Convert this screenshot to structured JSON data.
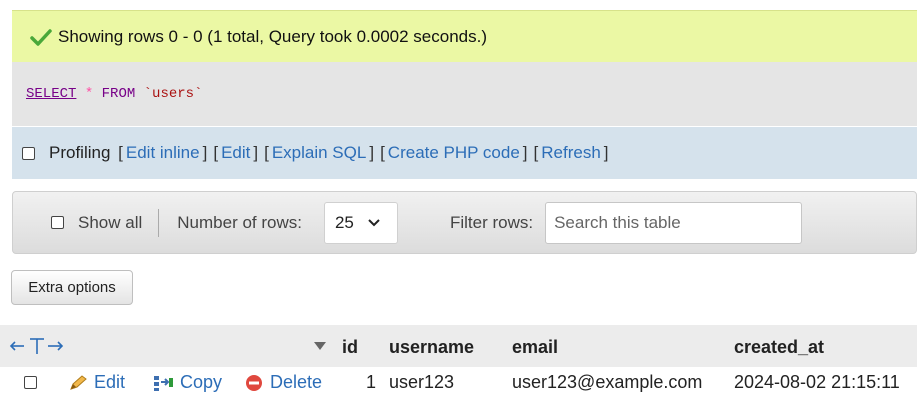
{
  "message": {
    "text": "Showing rows 0 - 0 (1 total, Query took 0.0002 seconds.)",
    "icon": "check-icon",
    "color": "#ebf8a4"
  },
  "sql": {
    "select": "SELECT",
    "star": "*",
    "from": "FROM",
    "table": "`users`"
  },
  "profiling": {
    "label": "Profiling",
    "links": [
      "Edit inline",
      "Edit",
      "Explain SQL",
      "Create PHP code",
      "Refresh"
    ]
  },
  "navigation": {
    "show_all": "Show all",
    "rows_label": "Number of rows:",
    "rows_value": "25",
    "filter_label": "Filter rows:",
    "search_placeholder": "Search this table"
  },
  "extra_options": "Extra options",
  "table": {
    "columns": [
      "id",
      "username",
      "email",
      "created_at"
    ],
    "rows": [
      {
        "actions": [
          "Edit",
          "Copy",
          "Delete"
        ],
        "id": "1",
        "username": "user123",
        "email": "user123@example.com",
        "created_at": "2024-08-02 21:15:11"
      }
    ]
  },
  "colors": {
    "link": "#2c6db7",
    "success_bg": "#ebf8a4",
    "profiling_bg": "#d5e2ec"
  }
}
